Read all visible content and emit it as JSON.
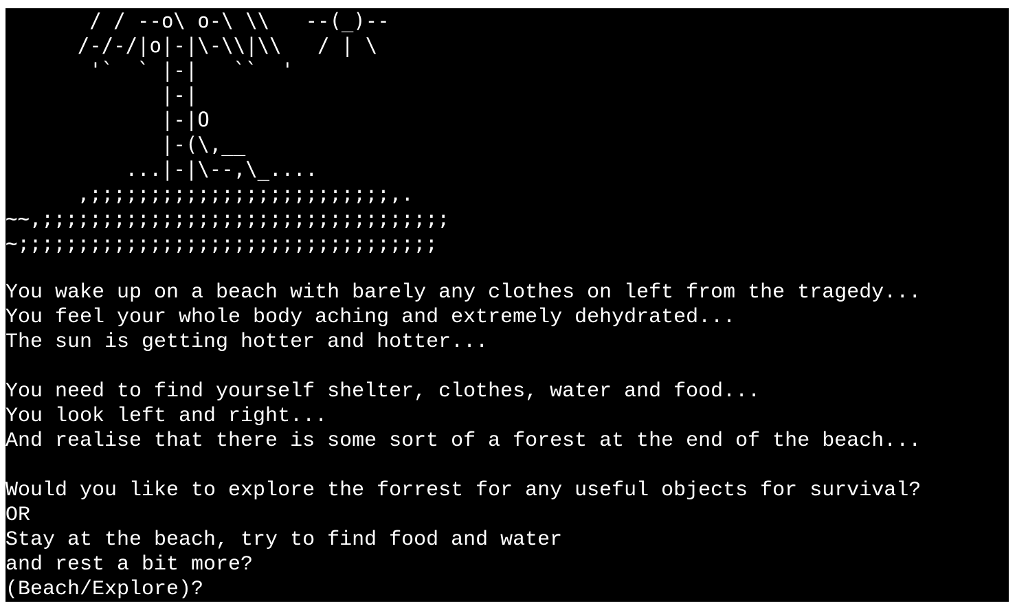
{
  "colors": {
    "terminal_background": "#000000",
    "terminal_text": "#ffffff",
    "page_background": "#ffffff"
  },
  "ascii_art": [
    "       / / --o\\ o-\\ \\\\   --(_)--",
    "      /-/-/|o|-|\\-\\\\|\\\\   / | \\",
    "       '`  ` |-|   ``  '",
    "             |-|",
    "             |-|O",
    "             |-(\\,__",
    "          ...|-|\\--,\\_....",
    "      ,;;;;;;;;;;;;;;;;;;;;;;;;;,.",
    "~~,;;;;;;;;;;;;;;;;;;;;;;;;;;;;;;;;;;",
    "~;;;;;;;;;;;;;;;;;;;;;;;;;;;;;;;;;;;"
  ],
  "story": {
    "intro": [
      "You wake up on a beach with barely any clothes on left from the tragedy...",
      "You feel your whole body aching and extremely dehydrated...",
      "The sun is getting hotter and hotter..."
    ],
    "goal": [
      "You need to find yourself shelter, clothes, water and food...",
      "You look left and right...",
      "And realise that there is some sort of a forest at the end of the beach..."
    ],
    "question": [
      "Would you like to explore the forrest for any useful objects for survival?",
      "OR",
      "Stay at the beach, try to find food and water",
      "and rest a bit more?"
    ],
    "prompt": "(Beach/Explore)?"
  }
}
